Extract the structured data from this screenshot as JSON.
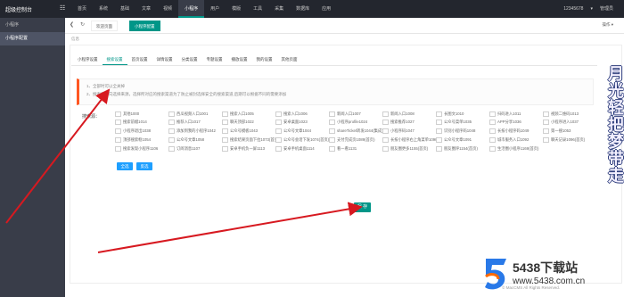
{
  "header": {
    "logo": "超级控制台",
    "menu_icon": "menu-icon",
    "nav": [
      "首页",
      "系统",
      "基础",
      "文章",
      "视频",
      "小程序",
      "用户",
      "模版",
      "工具",
      "采集",
      "数据库",
      "应用"
    ],
    "active_nav": "小程序",
    "user": "12345678",
    "user_menu": "▾",
    "account": "管理员"
  },
  "sidebar": {
    "title": "小程序",
    "items": [
      "小程序配置"
    ]
  },
  "tabs": {
    "items": [
      "欢迎页面",
      "小程序配置"
    ],
    "active": "小程序配置",
    "operations": "操作 ▾"
  },
  "breadcrumb": "信息",
  "subtabs": {
    "items": [
      "小程序设置",
      "搜索设置",
      "首页设置",
      "详情设置",
      "分类设置",
      "专题设置",
      "播放设置",
      "我的设置",
      "其他页面"
    ],
    "active": "搜索设置"
  },
  "tip": {
    "lines": [
      "1、全部时可以全关掉",
      "2、搜索的方向选择来源，选择所对应的搜索渠道为了防止被封选择安全的搜索渠道,后期可以根据不同的需要添加"
    ]
  },
  "search_channel": {
    "label": "搜索源：",
    "options": [
      "其他1000",
      "西瓜视频入口1001",
      "搜索入口1005",
      "搜索入口1006",
      "新闻入口1007",
      "新闻入口1008",
      "长图文1010",
      "扫码进入1011",
      "视频二维码1013",
      "搜索前缀1014",
      "推荐入口1017",
      "聊天顶部1022",
      "安卓桌面1023",
      "小程序profile1024",
      "搜索推荐1027",
      "公众号菜单1035",
      "APP分享1036",
      "小程序进入1037",
      "小程序退出1038",
      "添加到我的小程序1042",
      "公众号模板1043",
      "公众号文章1044",
      "shareTicket转发1044(集成)",
      "小程序码1047",
      "识别小程序码1048",
      "长按小程序码1049",
      "第一搜1053",
      "顶部搜索框1054",
      "公众号文章1058",
      "搜索结果页面下拉1073(首页)",
      "公众号会话下发1074(首页)",
      "支付完成页1089(首页)",
      "长按小程序右上角菜单1090",
      "公众号文章1091",
      "城市服务入口1092",
      "聊天记录1096(首页)",
      "搜索发现小程序1106",
      "订阅消息1107",
      "安卓手机负一屏1113",
      "安卓手机桌面1114",
      "看一看1131",
      "朋友圈更多1155(首页)",
      "朋友圈评1154(首页)",
      "生活圈小程序1169(首页)"
    ],
    "select_all": "全选",
    "invert": "反选"
  },
  "save_button": "保 存",
  "copyright": "© MacCMS All Rights Reserved.",
  "watermark": {
    "vertical_text": "月光轻把梦带走",
    "site_name": "5438下载站",
    "site_url": "www.5438.com.cn"
  },
  "colors": {
    "topbar": "#23262e",
    "sidebar": "#393d49",
    "accent": "#009688",
    "button_blue": "#1e9fff",
    "tip_border": "#ff5722",
    "annotation_arrow": "#d71920"
  }
}
